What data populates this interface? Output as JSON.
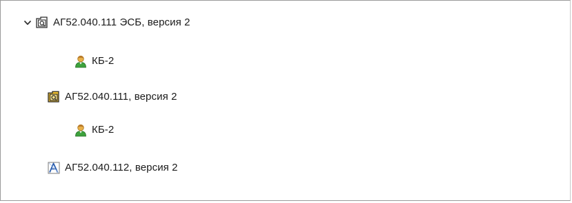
{
  "tree": {
    "nodes": [
      {
        "label": "АГ52.040.111 ЭСБ, версия 2",
        "icon": "assembly-doc-icon",
        "expanded": true
      },
      {
        "label": "КБ-2",
        "icon": "user-icon"
      },
      {
        "label": "АГ52.040.111, версия 2",
        "icon": "assembly-icon"
      },
      {
        "label": "КБ-2",
        "icon": "user-icon"
      },
      {
        "label": "АГ52.040.112, версия 2",
        "icon": "drawing-icon"
      }
    ]
  },
  "colors": {
    "assembly_fill": "#f0c030",
    "assembly_stroke": "#2a2a2a",
    "user_head": "#e8b048",
    "user_body": "#3da23d",
    "drawing_blue": "#2c5fb0",
    "chevron": "#333333",
    "border": "#9a9a9a"
  }
}
